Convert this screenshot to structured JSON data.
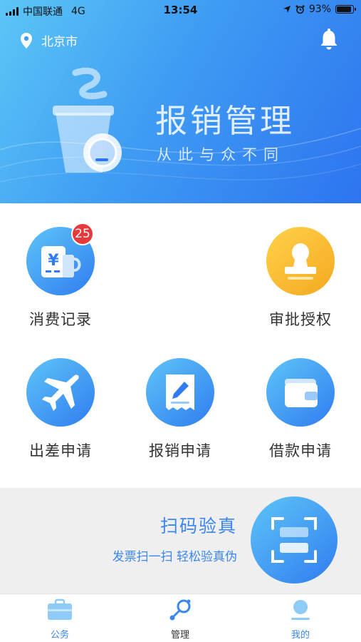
{
  "status_bar": {
    "carrier": "中国联通",
    "network": "4G",
    "time": "13:54",
    "battery": "93%",
    "battery_level": 0.93
  },
  "header": {
    "location": "北京市",
    "icons": [
      "location-pin-icon",
      "bell-icon"
    ]
  },
  "banner": {
    "title": "报销管理",
    "subtitle": "从此与众不同"
  },
  "grid": {
    "items": [
      {
        "label": "消费记录",
        "icon": "receipt-yen-icon",
        "badge": "25"
      },
      {
        "label": "审批授权",
        "icon": "stamp-icon"
      },
      {
        "label": "出差申请",
        "icon": "airplane-icon"
      },
      {
        "label": "报销申请",
        "icon": "document-edit-icon"
      },
      {
        "label": "借款申请",
        "icon": "wallet-icon"
      }
    ]
  },
  "scan": {
    "title": "扫码验真",
    "subtitle": "发票扫一扫 轻松验真伪",
    "icon": "scan-frame-icon"
  },
  "tabbar": {
    "tabs": [
      {
        "label": "公务",
        "icon": "briefcase-icon"
      },
      {
        "label": "管理",
        "icon": "manage-icon",
        "active": true
      },
      {
        "label": "我的",
        "icon": "profile-icon"
      }
    ]
  },
  "colors": {
    "accent": "#3b86f0",
    "badge": "#e6393b",
    "gold": "#f4a820"
  }
}
